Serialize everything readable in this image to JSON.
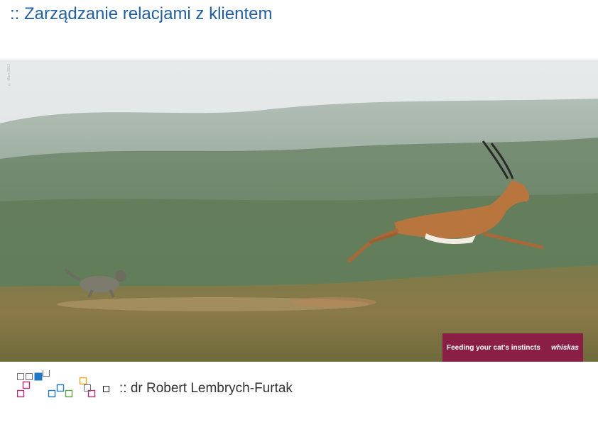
{
  "slide": {
    "title": ":: Zarządzanie relacjami z klientem",
    "author": ":: dr Robert Lembrych-Furtak"
  },
  "photo": {
    "side_credit": "© Mars 2013",
    "banner_tagline": "Feeding your cat's instincts",
    "banner_brand": "whiskas"
  },
  "colors": {
    "title": "#1f5fa8",
    "banner": "#8a1f46",
    "logo_blue": "#1f78c8",
    "logo_orange": "#f2a51e",
    "logo_green": "#5aa63a",
    "logo_magenta": "#c2277a",
    "logo_gray": "#6e6e6e"
  }
}
